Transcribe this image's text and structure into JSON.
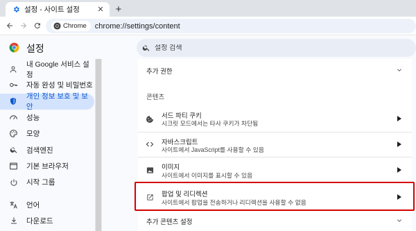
{
  "browser": {
    "tab_title": "설정 - 사이트 설정",
    "tab_close": "✕",
    "new_tab": "+",
    "omnibox_chip": "Chrome",
    "url": "chrome://settings/content"
  },
  "header": {
    "title": "설정",
    "search_placeholder": "설정 검색"
  },
  "sidebar": {
    "items": [
      {
        "label": "내 Google 서비스 설정",
        "icon": "person-icon"
      },
      {
        "label": "자동 완성 및 비밀번호",
        "icon": "key-icon"
      },
      {
        "label": "개인 정보 보호 및 보안",
        "icon": "shield-icon",
        "active": true
      },
      {
        "label": "성능",
        "icon": "speedometer-icon"
      },
      {
        "label": "모양",
        "icon": "palette-icon"
      },
      {
        "label": "검색엔진",
        "icon": "search-icon"
      },
      {
        "label": "기본 브라우저",
        "icon": "browser-icon"
      },
      {
        "label": "시작 그룹",
        "icon": "power-icon"
      },
      {
        "label": "언어",
        "icon": "translate-icon"
      },
      {
        "label": "다운로드",
        "icon": "download-icon"
      }
    ]
  },
  "main": {
    "additional_permissions": "추가 권한",
    "content_heading": "콘텐츠",
    "rows": [
      {
        "title": "서드 파티 쿠키",
        "subtitle": "시크릿 모드에서는 타사 쿠키가 차단됨",
        "icon": "cookie-icon"
      },
      {
        "title": "자바스크립트",
        "subtitle": "사이트에서 JavaScript를 사용할 수 있음",
        "icon": "code-icon"
      },
      {
        "title": "이미지",
        "subtitle": "사이트에서 이미지를 표시할 수 있음",
        "icon": "image-icon"
      },
      {
        "title": "팝업 및 리디렉션",
        "subtitle": "사이트에서 팝업을 전송하거나 리디렉션을 사용할 수 없음",
        "icon": "open-in-new-icon"
      }
    ],
    "additional_content": "추가 콘텐츠 설정"
  },
  "colors": {
    "accent": "#0b57d0",
    "active_bg": "#d3e3fd",
    "highlight_border": "#d50000"
  }
}
